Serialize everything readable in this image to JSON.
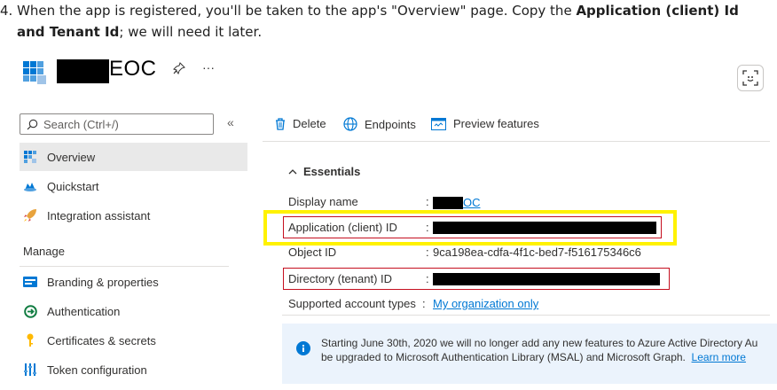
{
  "instruction": {
    "line1_prefix": "4. When the app is registered, you'll be taken to the app's \"Overview\" page. Copy the ",
    "line1_bold": "Application (client) Id",
    "line2_bold": "and Tenant Id",
    "line2_suffix": "; we will need it later."
  },
  "header": {
    "app_title_suffix": "EOC",
    "pin_icon": "pin-icon",
    "more_label": "···",
    "feedback_icon": "feedback-icon"
  },
  "sidebar": {
    "search_placeholder": "Search (Ctrl+/)",
    "collapse_label": "«",
    "items": [
      {
        "label": "Overview",
        "icon": "overview-icon"
      },
      {
        "label": "Quickstart",
        "icon": "quickstart-icon"
      },
      {
        "label": "Integration assistant",
        "icon": "rocket-icon"
      }
    ],
    "manage_label": "Manage",
    "manage_items": [
      {
        "label": "Branding & properties",
        "icon": "branding-icon"
      },
      {
        "label": "Authentication",
        "icon": "authentication-icon"
      },
      {
        "label": "Certificates & secrets",
        "icon": "key-icon"
      },
      {
        "label": "Token configuration",
        "icon": "token-icon"
      }
    ]
  },
  "toolbar": {
    "delete_label": "Delete",
    "endpoints_label": "Endpoints",
    "preview_label": "Preview features"
  },
  "essentials": {
    "heading": "Essentials",
    "fields": {
      "display_name": {
        "label": "Display name",
        "value_suffix": "OC"
      },
      "app_id": {
        "label": "Application (client) ID"
      },
      "object_id": {
        "label": "Object ID",
        "value": "9ca198ea-cdfa-4f1c-bed7-f516175346c6"
      },
      "tenant_id": {
        "label": "Directory (tenant) ID"
      },
      "account_types": {
        "label": "Supported account types",
        "value": "My organization only"
      }
    },
    "colon": ":"
  },
  "banner": {
    "line1": "Starting June 30th, 2020 we will no longer add any new features to Azure Active Directory Au",
    "line2": "be upgraded to Microsoft Authentication Library (MSAL) and Microsoft Graph.",
    "link": "Learn more"
  },
  "colors": {
    "accent": "#0078d4",
    "highlight_yellow": "#fff200",
    "highlight_red": "#c50f1f",
    "redaction": "#000000"
  }
}
